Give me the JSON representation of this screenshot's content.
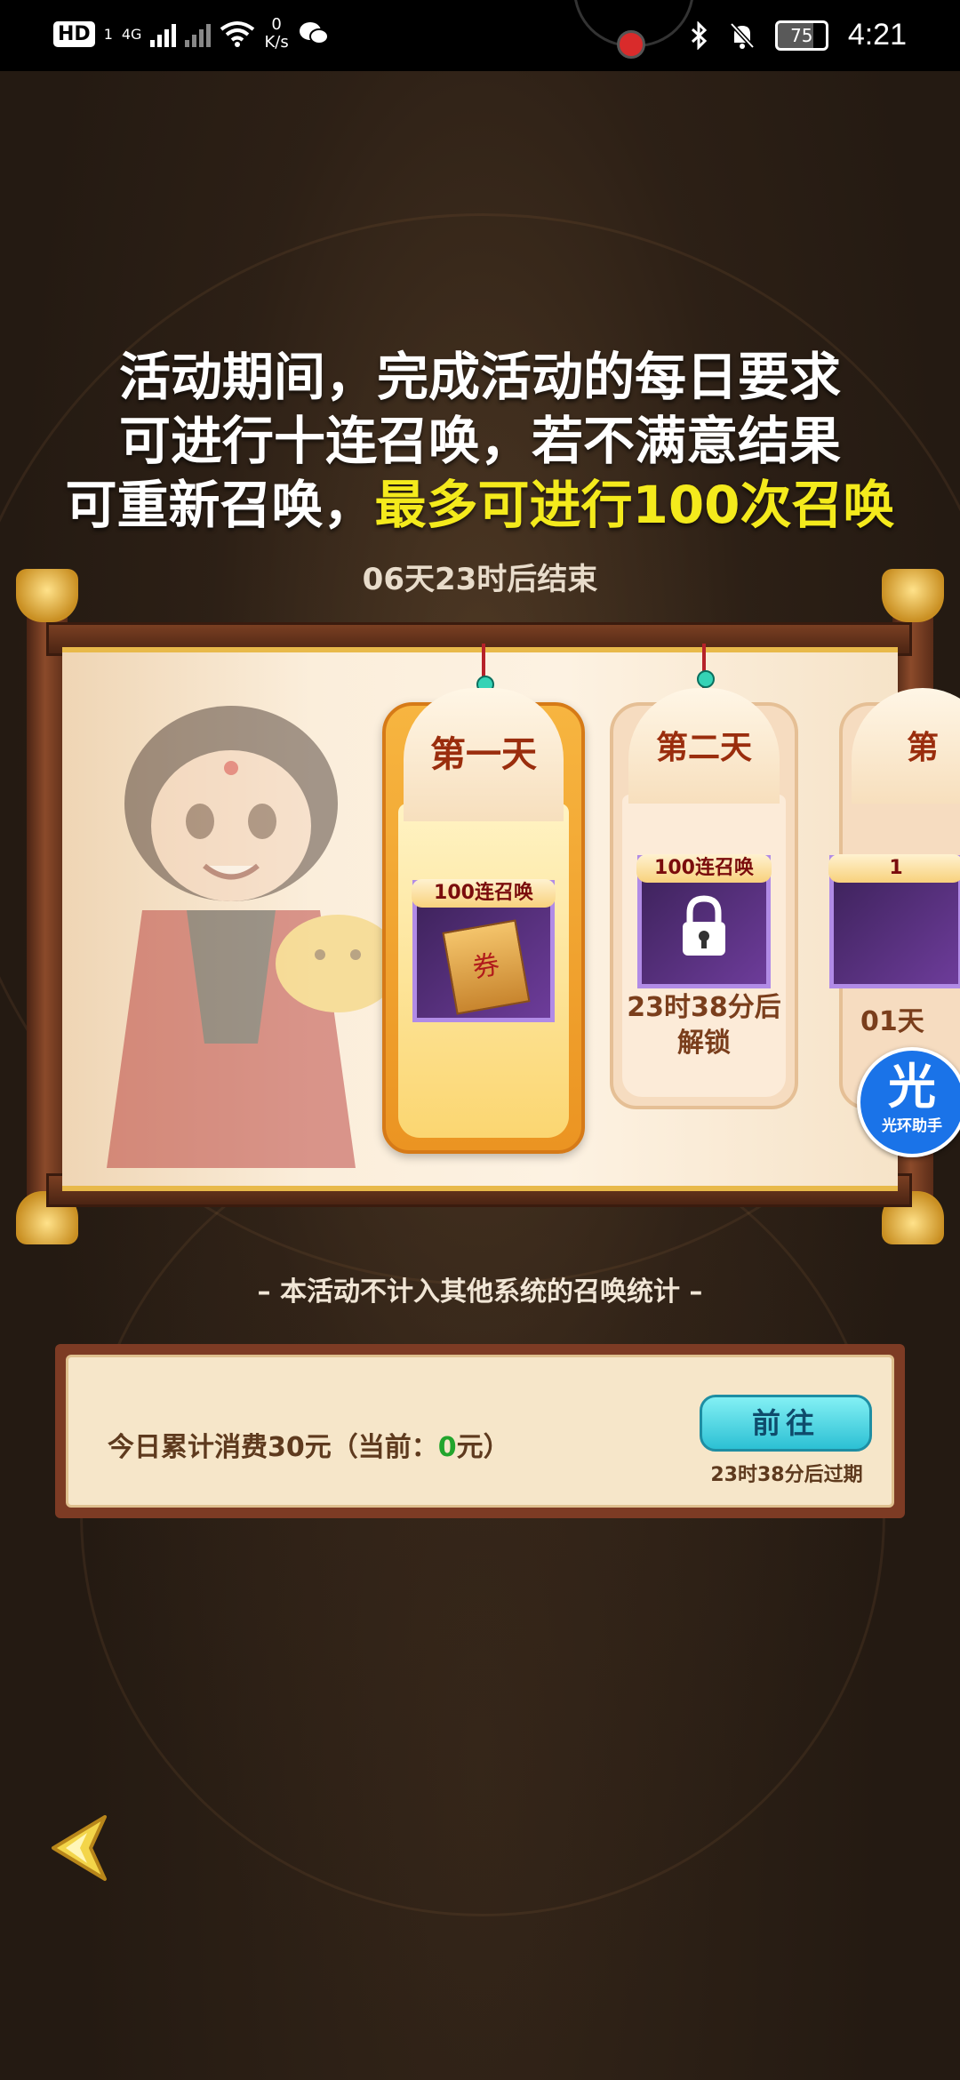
{
  "status_bar": {
    "hd": "HD",
    "sim": "1",
    "network": "4G",
    "speed_value": "0",
    "speed_unit": "K/s",
    "battery": "75",
    "time": "4:21"
  },
  "headline": {
    "line1": "活动期间，完成活动的每日要求",
    "line2": "可进行十连召唤，若不满意结果",
    "line3_prefix": "可重新召唤，",
    "line3_highlight": "最多可进行100次召唤"
  },
  "countdown": "06天23时后结束",
  "days": {
    "day1": {
      "title": "第一天",
      "item_label": "100连召唤",
      "ticket_char": "券"
    },
    "day2": {
      "title": "第二天",
      "item_label": "100连召唤",
      "unlock_line1": "23时38分后",
      "unlock_line2": "解锁"
    },
    "day3": {
      "title": "第",
      "item_label": "1",
      "unlock_partial": "01天"
    }
  },
  "helper": {
    "big": "光",
    "small": "光环助手"
  },
  "note": "– 本活动不计入其他系统的召唤统计 –",
  "task": {
    "text_prefix": "今日累计消费30元（当前：",
    "current_value": "0",
    "text_suffix": "元）",
    "button_label": "前往",
    "expire_text": "23时38分后过期"
  },
  "colors": {
    "highlight": "#f4ea1c",
    "current_value": "#22a52c",
    "button": "#2cc0d4"
  }
}
